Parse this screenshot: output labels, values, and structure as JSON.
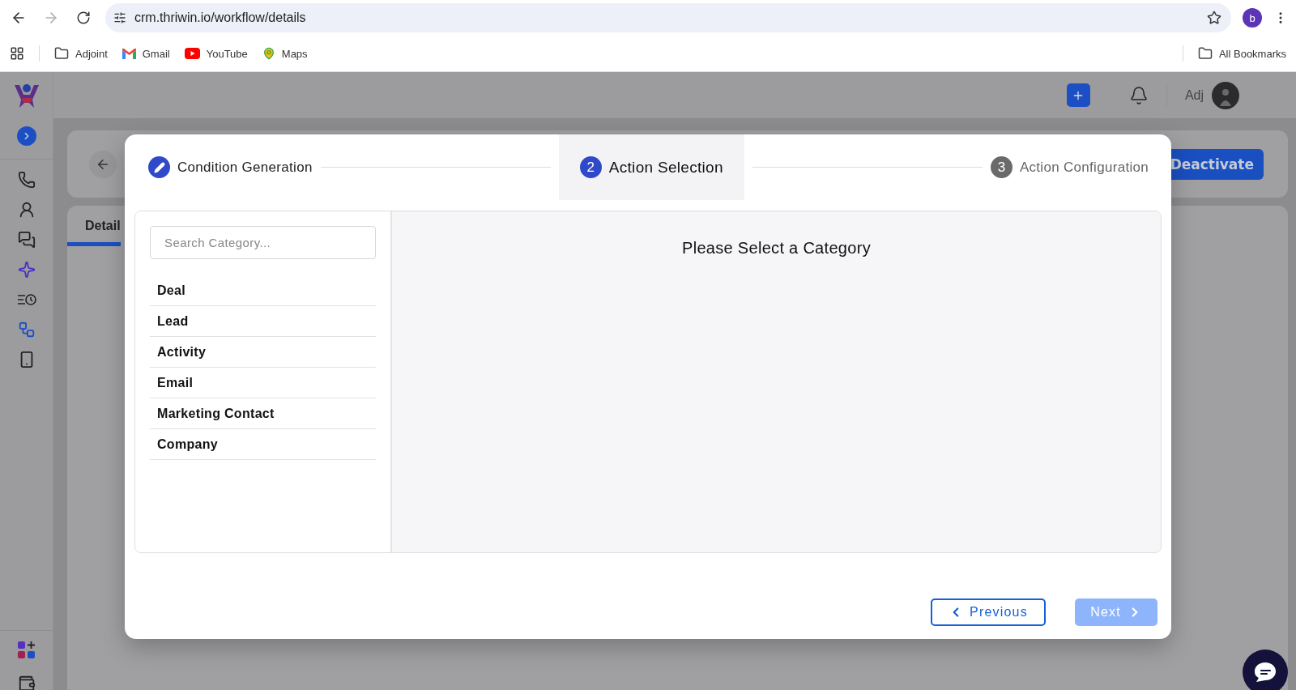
{
  "browser": {
    "url": "crm.thriwin.io/workflow/details",
    "profile_initial": "b",
    "bookmarks": [
      {
        "label": "Adjoint",
        "kind": "folder"
      },
      {
        "label": "Gmail",
        "kind": "gmail"
      },
      {
        "label": "YouTube",
        "kind": "youtube"
      },
      {
        "label": "Maps",
        "kind": "maps"
      }
    ],
    "all_bookmarks": "All Bookmarks"
  },
  "header": {
    "user": "Adj"
  },
  "page": {
    "action_button": "Deactivate",
    "tabs": [
      {
        "label": "Detail",
        "selected": true
      }
    ]
  },
  "modal": {
    "steps": [
      {
        "label": "Condition Generation",
        "completed": true,
        "selected": false
      },
      {
        "number": "2",
        "label": "Action Selection",
        "completed": false,
        "selected": true
      },
      {
        "number": "3",
        "label": "Action Configuration",
        "completed": false,
        "selected": false
      }
    ],
    "search": {
      "placeholder": "Search Category..."
    },
    "categories": [
      {
        "label": "Deal",
        "selected": false
      },
      {
        "label": "Lead",
        "selected": false
      },
      {
        "label": "Activity",
        "selected": false
      },
      {
        "label": "Email",
        "selected": false
      },
      {
        "label": "Marketing Contact",
        "selected": false
      },
      {
        "label": "Company",
        "selected": false
      }
    ],
    "panel_title": "Please Select a Category",
    "buttons": [
      {
        "label": "Previous",
        "kind": "previous",
        "disabled": false
      },
      {
        "label": "Next",
        "kind": "next",
        "disabled": true
      }
    ]
  }
}
